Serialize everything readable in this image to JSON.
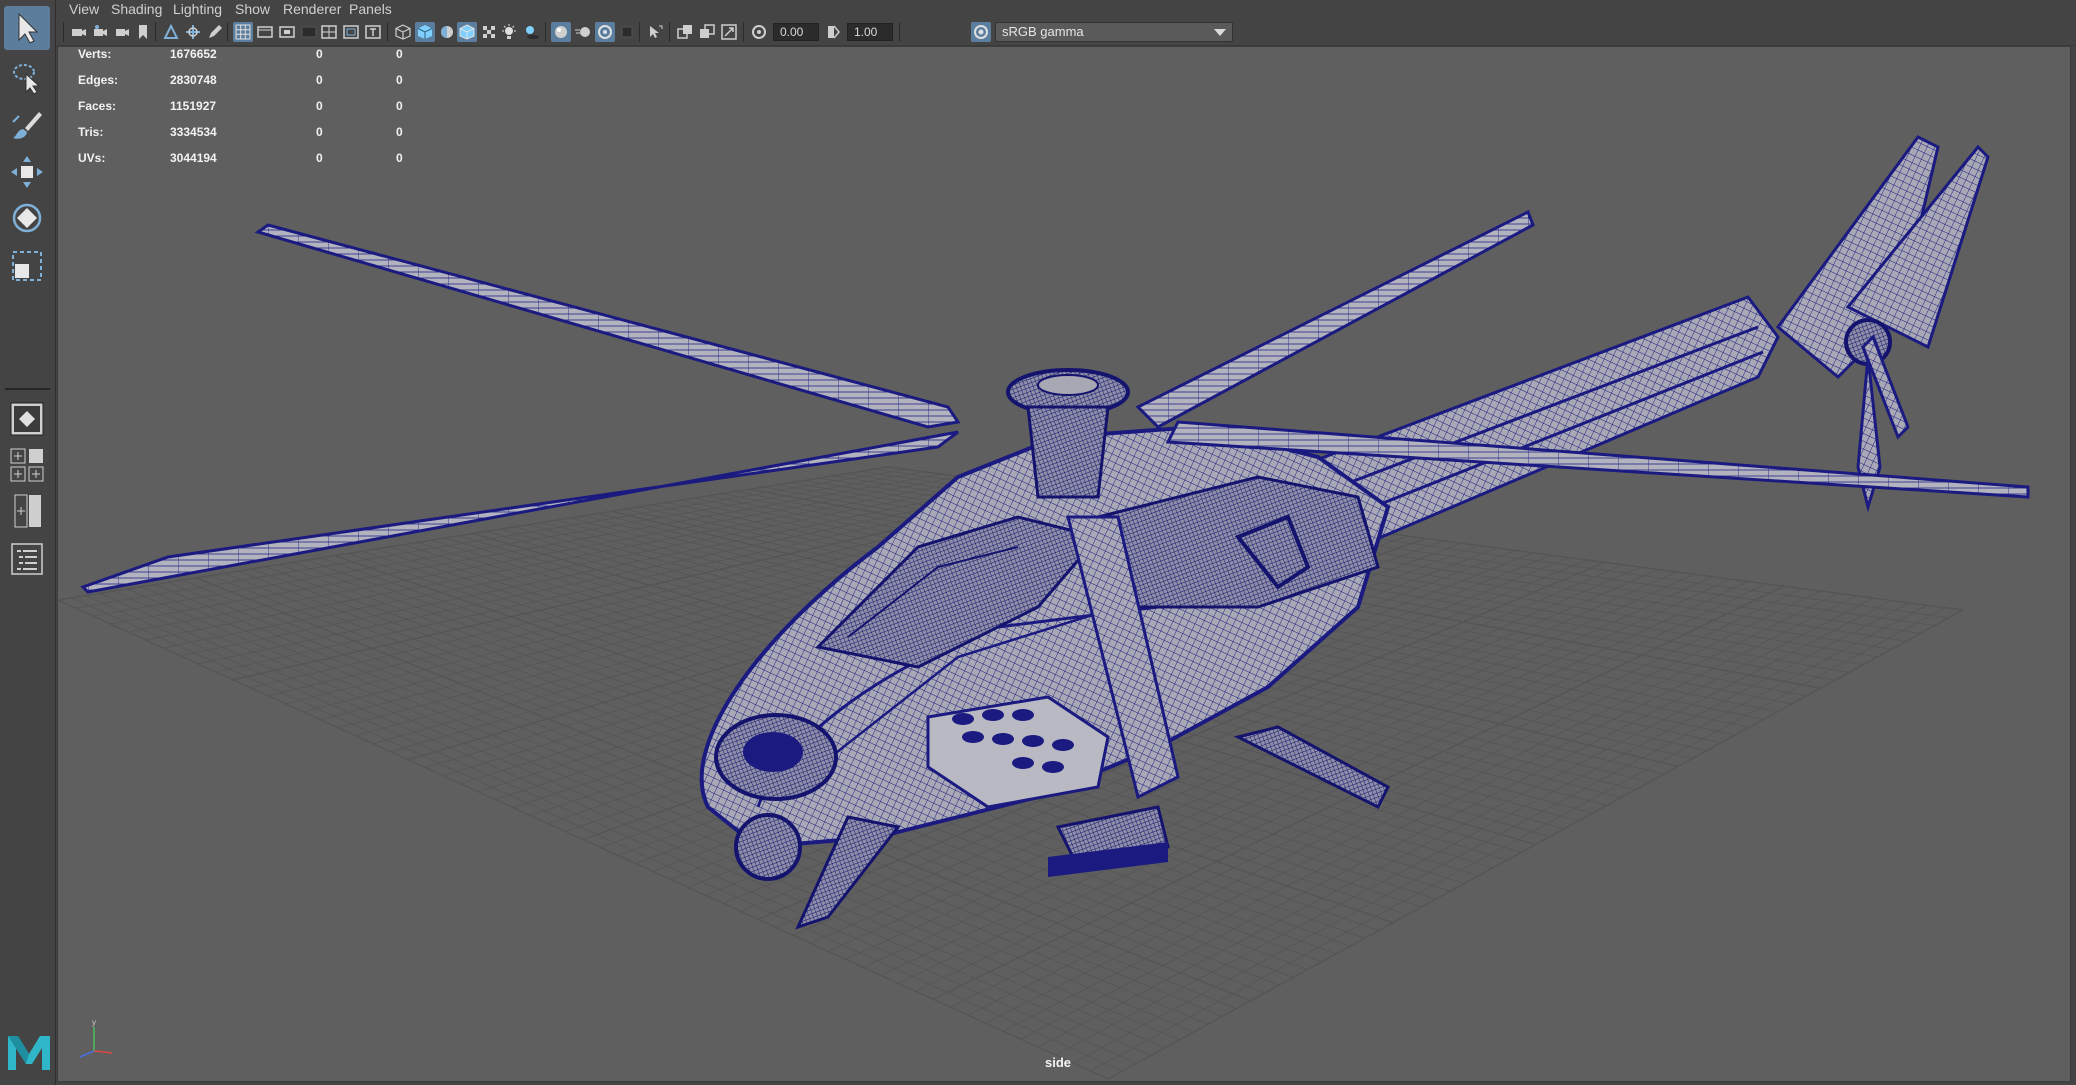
{
  "menubar": {
    "items": [
      "View",
      "Shading",
      "Lighting",
      "Show",
      "Renderer",
      "Panels"
    ]
  },
  "toolbar": {
    "exposure_value": "0.00",
    "gamma_value": "1.00",
    "color_space": "sRGB gamma"
  },
  "hud": {
    "rows": [
      {
        "label": "Verts:",
        "v1": "1676652",
        "v2": "0",
        "v3": "0"
      },
      {
        "label": "Edges:",
        "v1": "2830748",
        "v2": "0",
        "v3": "0"
      },
      {
        "label": "Faces:",
        "v1": "1151927",
        "v2": "0",
        "v3": "0"
      },
      {
        "label": "Tris:",
        "v1": "3334534",
        "v2": "0",
        "v3": "0"
      },
      {
        "label": "UVs:",
        "v1": "3044194",
        "v2": "0",
        "v3": "0"
      }
    ]
  },
  "viewport": {
    "camera": "side",
    "wireframe_color": "#1a1a80",
    "surface_color": "#a8a8b4",
    "grid_color": "#555555"
  },
  "toolbox": {
    "tools": [
      "select-tool",
      "lasso-tool",
      "paint-select-tool",
      "move-tool",
      "rotate-tool",
      "scale-tool"
    ],
    "accent": "#5d7d9c"
  },
  "logo": "M"
}
